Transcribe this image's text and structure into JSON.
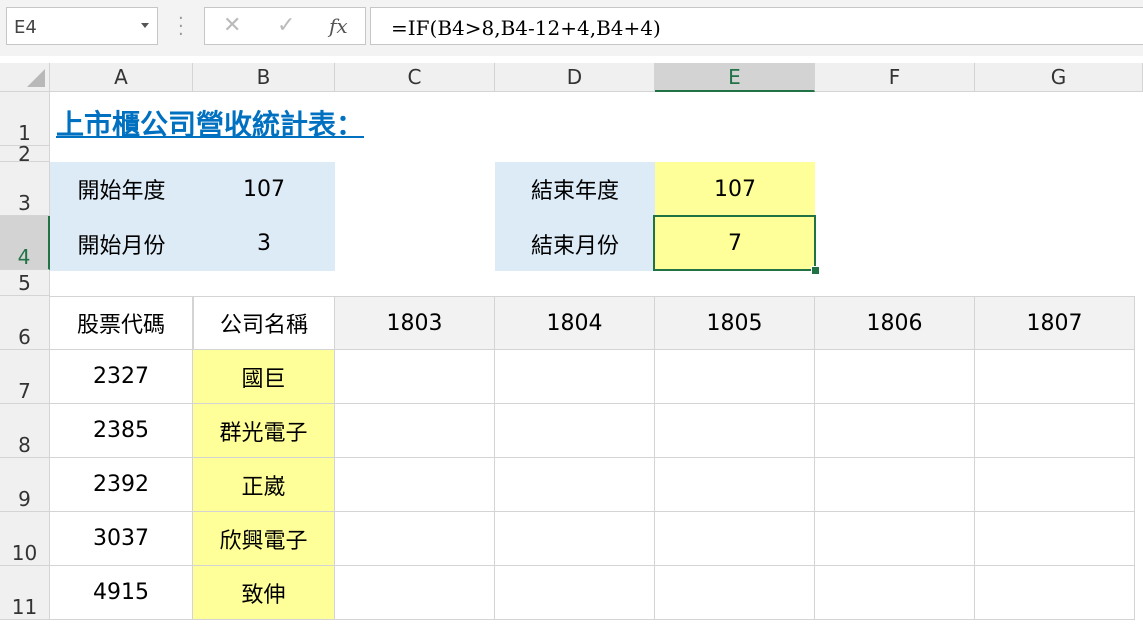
{
  "formula_bar": {
    "name_box": "E4",
    "cancel_icon": "✕",
    "enter_icon": "✓",
    "fx_label": "fx",
    "formula": "=IF(B4>8,B4-12+4,B4+4)"
  },
  "columns": [
    "A",
    "B",
    "C",
    "D",
    "E",
    "F",
    "G"
  ],
  "rows": [
    "1",
    "2",
    "3",
    "4",
    "5",
    "6",
    "7",
    "8",
    "9",
    "10",
    "11"
  ],
  "selected_cell": "E4",
  "title": "上市櫃公司營收統計表：",
  "params": {
    "start_year_label": "開始年度",
    "start_year_value": "107",
    "start_month_label": "開始月份",
    "start_month_value": "3",
    "end_year_label": "結束年度",
    "end_year_value": "107",
    "end_month_label": "結束月份",
    "end_month_value": "7"
  },
  "table": {
    "headers": [
      "股票代碼",
      "公司名稱",
      "1803",
      "1804",
      "1805",
      "1806",
      "1807"
    ],
    "rows": [
      {
        "code": "2327",
        "name": "國巨"
      },
      {
        "code": "2385",
        "name": "群光電子"
      },
      {
        "code": "2392",
        "name": "正崴"
      },
      {
        "code": "3037",
        "name": "欣興電子"
      },
      {
        "code": "4915",
        "name": "致伸"
      }
    ]
  },
  "colors": {
    "blue_fill": "#ddebf7",
    "yellow_fill": "#ffff99",
    "title_color": "#0070c0",
    "selection": "#217346"
  }
}
